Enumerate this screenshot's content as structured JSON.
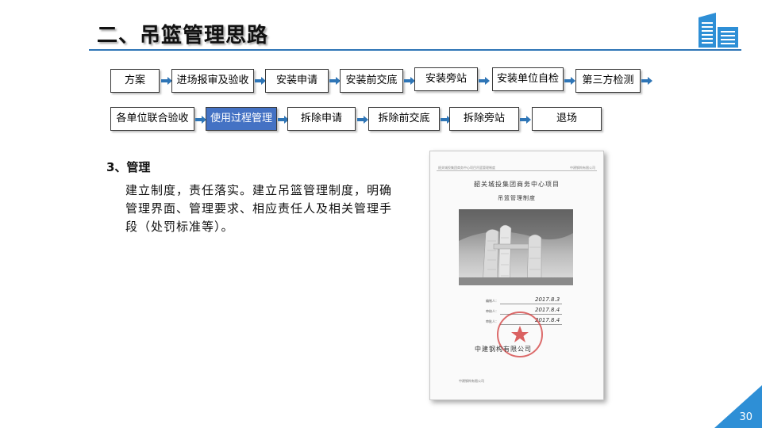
{
  "slide": {
    "title": "二、吊篮管理思路",
    "page_number": "30",
    "accent_color": "#2e75b6",
    "active_color": "#4472c4"
  },
  "flow": {
    "row1": [
      "方案",
      "进场报审及验收",
      "安装申请",
      "安装前交底",
      "安装旁站",
      "安装单位自检",
      "第三方检测"
    ],
    "row2": [
      "各单位联合验收",
      "使用过程管理",
      "拆除申请",
      "拆除前交底",
      "拆除旁站",
      "退场"
    ],
    "active_step": "使用过程管理"
  },
  "section": {
    "heading": "3、管理",
    "body": "建立制度，责任落实。建立吊篮管理制度，明确管理界面、管理要求、相应责任人及相关管理手段（处罚标准等）。"
  },
  "document": {
    "header_left": "韶关城投集团商务中心项目吊篮管理制度",
    "header_right": "中建钢构有限公司",
    "title": "韶关城投集团商务中心项目",
    "subtitle": "吊篮管理制度",
    "sign_rows": [
      "编制人：",
      "审核人：",
      "审批人："
    ],
    "sign_dates": [
      "2017.8.3",
      "2017.8.4",
      "2017.8.4"
    ],
    "company": "中建钢构有限公司",
    "footer": "中建钢构有限公司"
  },
  "icons": {
    "logo": "building-logo-icon",
    "arrow": "right-arrow-icon"
  }
}
